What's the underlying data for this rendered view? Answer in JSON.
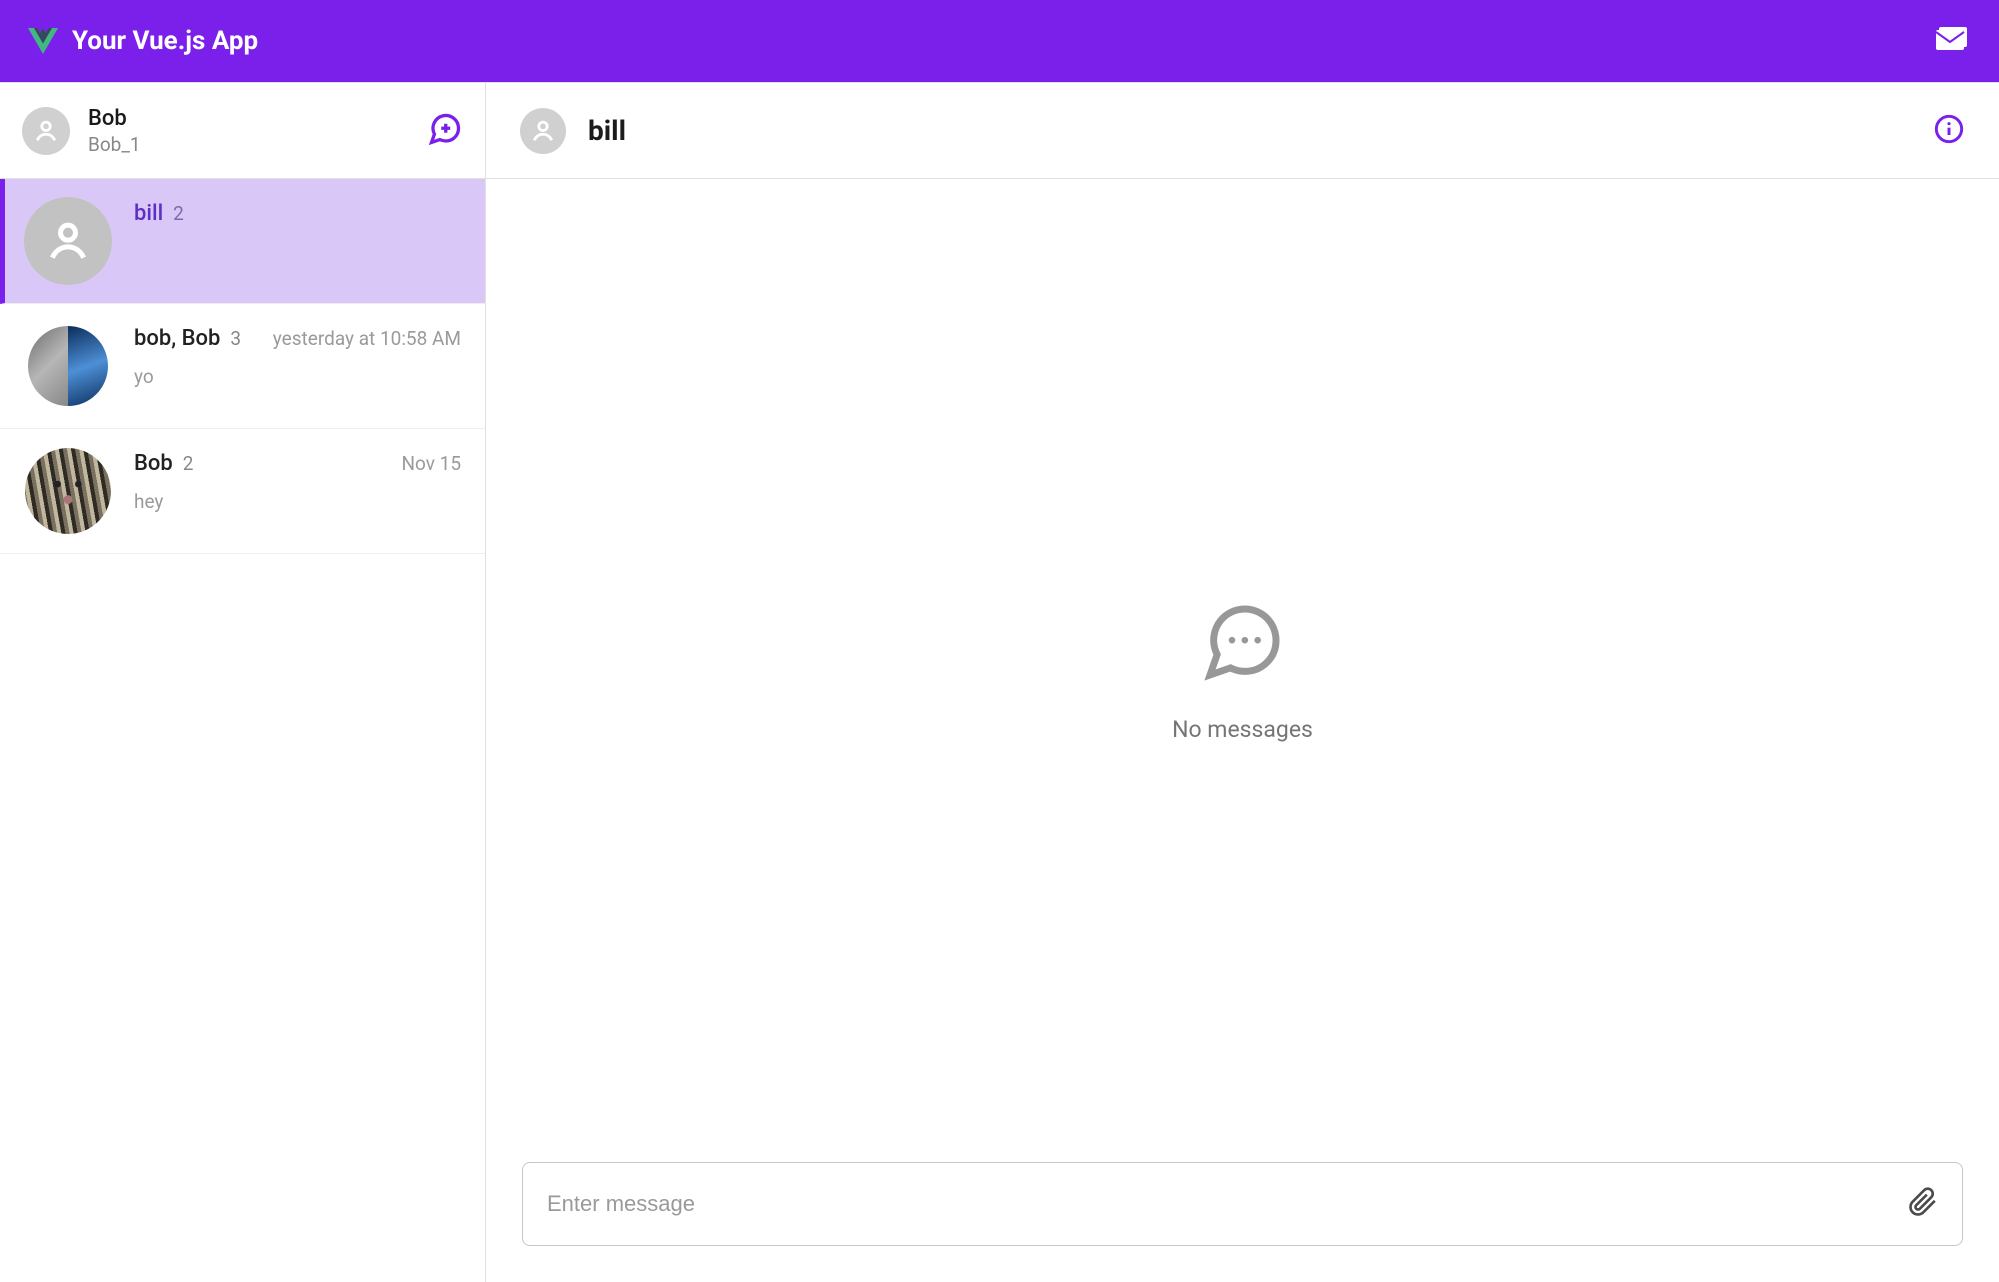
{
  "header": {
    "title": "Your Vue.js App"
  },
  "sidebar": {
    "user": {
      "name": "Bob",
      "handle": "Bob_1"
    }
  },
  "conversations": [
    {
      "title": "bill",
      "count": "2",
      "time": "",
      "preview": ""
    },
    {
      "title": "bob, Bob",
      "count": "3",
      "time": "yesterday at 10:58 AM",
      "preview": "yo"
    },
    {
      "title": "Bob",
      "count": "2",
      "time": "Nov 15",
      "preview": "hey"
    }
  ],
  "chat": {
    "title": "bill",
    "empty_text": "No messages"
  },
  "composer": {
    "placeholder": "Enter message"
  }
}
